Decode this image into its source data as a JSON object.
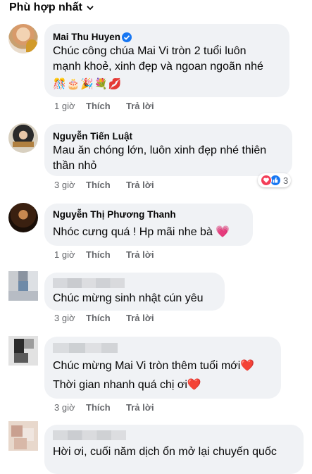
{
  "header": {
    "sort_label": "Phù hợp nhất"
  },
  "comments": [
    {
      "name": "Mai Thu Huyen",
      "verified": true,
      "lines": [
        "Chúc công chúa Mai Vi tròn 2 tuổi luôn",
        "mạnh khoẻ, xinh đẹp và ngoan ngoãn nhé"
      ],
      "emojis": "🎊🎂🎉💐💋",
      "time": "1 giờ",
      "like": "Thích",
      "reply": "Trả lời"
    },
    {
      "name": "Nguyễn Tiến Luật",
      "lines": [
        "Mau ăn chóng lớn, luôn xinh đẹp nhé thiên",
        "thần nhỏ"
      ],
      "reaction_count": "3",
      "time": "3 giờ",
      "like": "Thích",
      "reply": "Trả lời"
    },
    {
      "name": "Nguyễn Thị Phương Thanh",
      "lines": [
        "Nhóc cưng quá ! Hp mãi nhe bà 💗"
      ],
      "time": "1 giờ",
      "like": "Thích",
      "reply": "Trả lời"
    },
    {
      "lines": [
        "Chúc mừng sinh nhật cún yêu"
      ],
      "time": "3 giờ",
      "like": "Thích",
      "reply": "Trả lời"
    },
    {
      "lines": [
        "Chúc mừng Mai Vi tròn thêm tuổi mới❤️",
        "Thời gian nhanh quá chị ơi❤️"
      ],
      "time": "3 giờ",
      "like": "Thích",
      "reply": "Trả lời"
    },
    {
      "lines": [
        "Hời ơi, cuối năm dịch ổn mở lại chuyến quốc"
      ]
    }
  ],
  "colors": {
    "bubble": "#f0f2f5",
    "meta": "#65676b",
    "text": "#050505",
    "accent": "#1877f2"
  }
}
